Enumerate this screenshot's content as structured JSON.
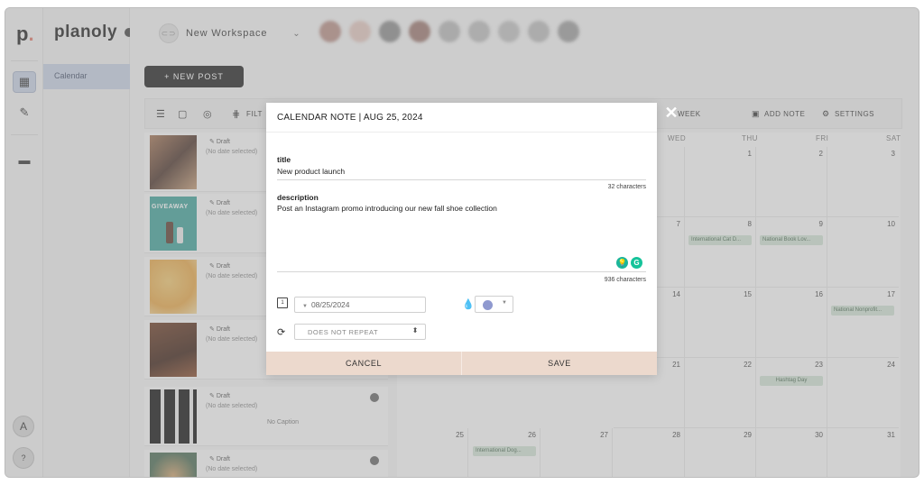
{
  "app": {
    "rail_logo": "p",
    "brand": "planoly",
    "sidebar_item": "Calendar",
    "avatar_initial": "A",
    "help": "?"
  },
  "header": {
    "workspace_name": "New Workspace"
  },
  "toolbar": {
    "new_post": "+ NEW POST",
    "filter": "FILT",
    "week": "WEEK",
    "add_note": "ADD NOTE",
    "settings": "SETTINGS"
  },
  "posts": [
    {
      "status": "Draft",
      "date": "(No date selected)",
      "caption": ""
    },
    {
      "status": "Draft",
      "date": "(No date selected)",
      "caption": "",
      "thumb_text": "GIVEAWAY"
    },
    {
      "status": "Draft",
      "date": "(No date selected)",
      "caption": ""
    },
    {
      "status": "Draft",
      "date": "(No date selected)",
      "caption": ""
    },
    {
      "status": "Draft",
      "date": "(No date selected)",
      "caption": "No Caption"
    },
    {
      "status": "Draft",
      "date": "(No date selected)",
      "caption": ""
    }
  ],
  "calendar": {
    "days_visible": [
      "WED",
      "THU",
      "FRI",
      "SAT"
    ],
    "rows": [
      [
        "",
        "1",
        "2",
        "3"
      ],
      [
        "7",
        "8",
        "9",
        "10"
      ],
      [
        "14",
        "15",
        "16",
        "17"
      ],
      [
        "21",
        "22",
        "23",
        "24"
      ]
    ],
    "bottom_row": [
      "25",
      "26",
      "27",
      "28",
      "29",
      "30",
      "31"
    ],
    "events": {
      "e8": "International Cat D...",
      "e9": "National Book Lov...",
      "e17": "National Nonprofit...",
      "e23": "Hashtag Day",
      "e26": "International Dog..."
    }
  },
  "modal": {
    "title": "CALENDAR NOTE | AUG 25, 2024",
    "title_label": "title",
    "title_value": "New product launch",
    "title_count": "32 characters",
    "desc_label": "description",
    "desc_value": "Post an Instagram promo introducing our new fall shoe collection",
    "desc_count": "936 characters",
    "date_value": "08/25/2024",
    "repeat_value": "DOES NOT REPEAT",
    "cancel": "CANCEL",
    "save": "SAVE",
    "note_color": "#8f99cf"
  },
  "colors": {
    "accent_button": "#ecd9cd",
    "active_nav": "#c9d3e6",
    "event_fill": "#d3e4d6"
  },
  "icons": [
    "calendar-icon",
    "pencil-icon",
    "briefcase-icon",
    "list-icon",
    "grid-icon",
    "instagram-icon",
    "close-icon",
    "droplet-icon",
    "repeat-icon",
    "grammarly-icon"
  ]
}
